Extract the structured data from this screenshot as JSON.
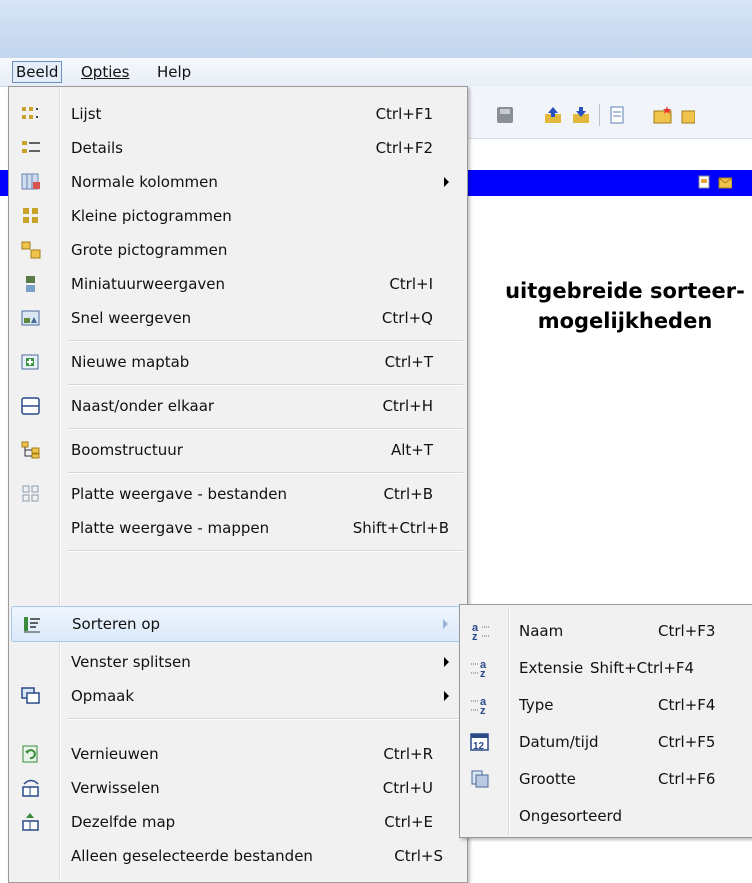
{
  "menubar": {
    "items": [
      "Beeld",
      "Opties",
      "Help"
    ]
  },
  "side_text": {
    "line1": "uitgebreide sorteer-",
    "line2": "mogelijkheden"
  },
  "menu": {
    "items": [
      {
        "label": "Lijst",
        "shortcut": "Ctrl+F1",
        "icon": "list-icon"
      },
      {
        "label": "Details",
        "shortcut": "Ctrl+F2",
        "icon": "details-icon"
      },
      {
        "label": "Normale kolommen",
        "shortcut": "",
        "icon": "columns-icon",
        "submenu": true
      },
      {
        "label": "Kleine pictogrammen",
        "shortcut": "",
        "icon": "small-icons-icon"
      },
      {
        "label": "Grote pictogrammen",
        "shortcut": "",
        "icon": "large-icons-icon"
      },
      {
        "label": "Miniatuurweergaven",
        "shortcut": "Ctrl+I",
        "icon": "thumbnails-icon"
      },
      {
        "label": "Snel weergeven",
        "shortcut": "Ctrl+Q",
        "icon": "quick-view-icon"
      },
      {
        "label": "Nieuwe maptab",
        "shortcut": "Ctrl+T",
        "icon": "new-tab-icon"
      },
      {
        "label": "Naast/onder elkaar",
        "shortcut": "Ctrl+H",
        "icon": "split-icon"
      },
      {
        "label": "Boomstructuur",
        "shortcut": "Alt+T",
        "icon": "tree-icon"
      },
      {
        "label": "Platte weergave - bestanden",
        "shortcut": "Ctrl+B",
        "icon": "flat-view-icon"
      },
      {
        "label": "Platte weergave - mappen",
        "shortcut": "Shift+Ctrl+B",
        "icon": ""
      },
      {
        "label": "Sorteren op",
        "shortcut": "",
        "icon": "sort-icon",
        "submenu": true,
        "highlighted": true
      },
      {
        "label": "Venster splitsen",
        "shortcut": "",
        "icon": "",
        "submenu": true
      },
      {
        "label": "Opmaak",
        "shortcut": "",
        "icon": "format-icon",
        "submenu": true
      },
      {
        "label": "Vernieuwen",
        "shortcut": "Ctrl+R",
        "icon": "refresh-icon"
      },
      {
        "label": "Verwisselen",
        "shortcut": "Ctrl+U",
        "icon": "swap-icon"
      },
      {
        "label": "Dezelfde map",
        "shortcut": "Ctrl+E",
        "icon": "same-folder-icon"
      },
      {
        "label": "Alleen geselecteerde bestanden",
        "shortcut": "Ctrl+S",
        "icon": ""
      }
    ]
  },
  "submenu": {
    "items": [
      {
        "label": "Naam",
        "shortcut": "Ctrl+F3",
        "icon": "sort-name-icon"
      },
      {
        "label": "Extensie",
        "shortcut": "Shift+Ctrl+F4",
        "icon": "sort-extension-icon"
      },
      {
        "label": "Type",
        "shortcut": "Ctrl+F4",
        "icon": "sort-type-icon"
      },
      {
        "label": "Datum/tijd",
        "shortcut": "Ctrl+F5",
        "icon": "sort-date-icon"
      },
      {
        "label": "Grootte",
        "shortcut": "Ctrl+F6",
        "icon": "sort-size-icon"
      },
      {
        "label": "Ongesorteerd",
        "shortcut": "",
        "icon": ""
      }
    ]
  },
  "colors": {
    "accent_bar": "#0000ff",
    "menu_bg": "#f1f1f1",
    "highlight": "#dbe9f9"
  }
}
